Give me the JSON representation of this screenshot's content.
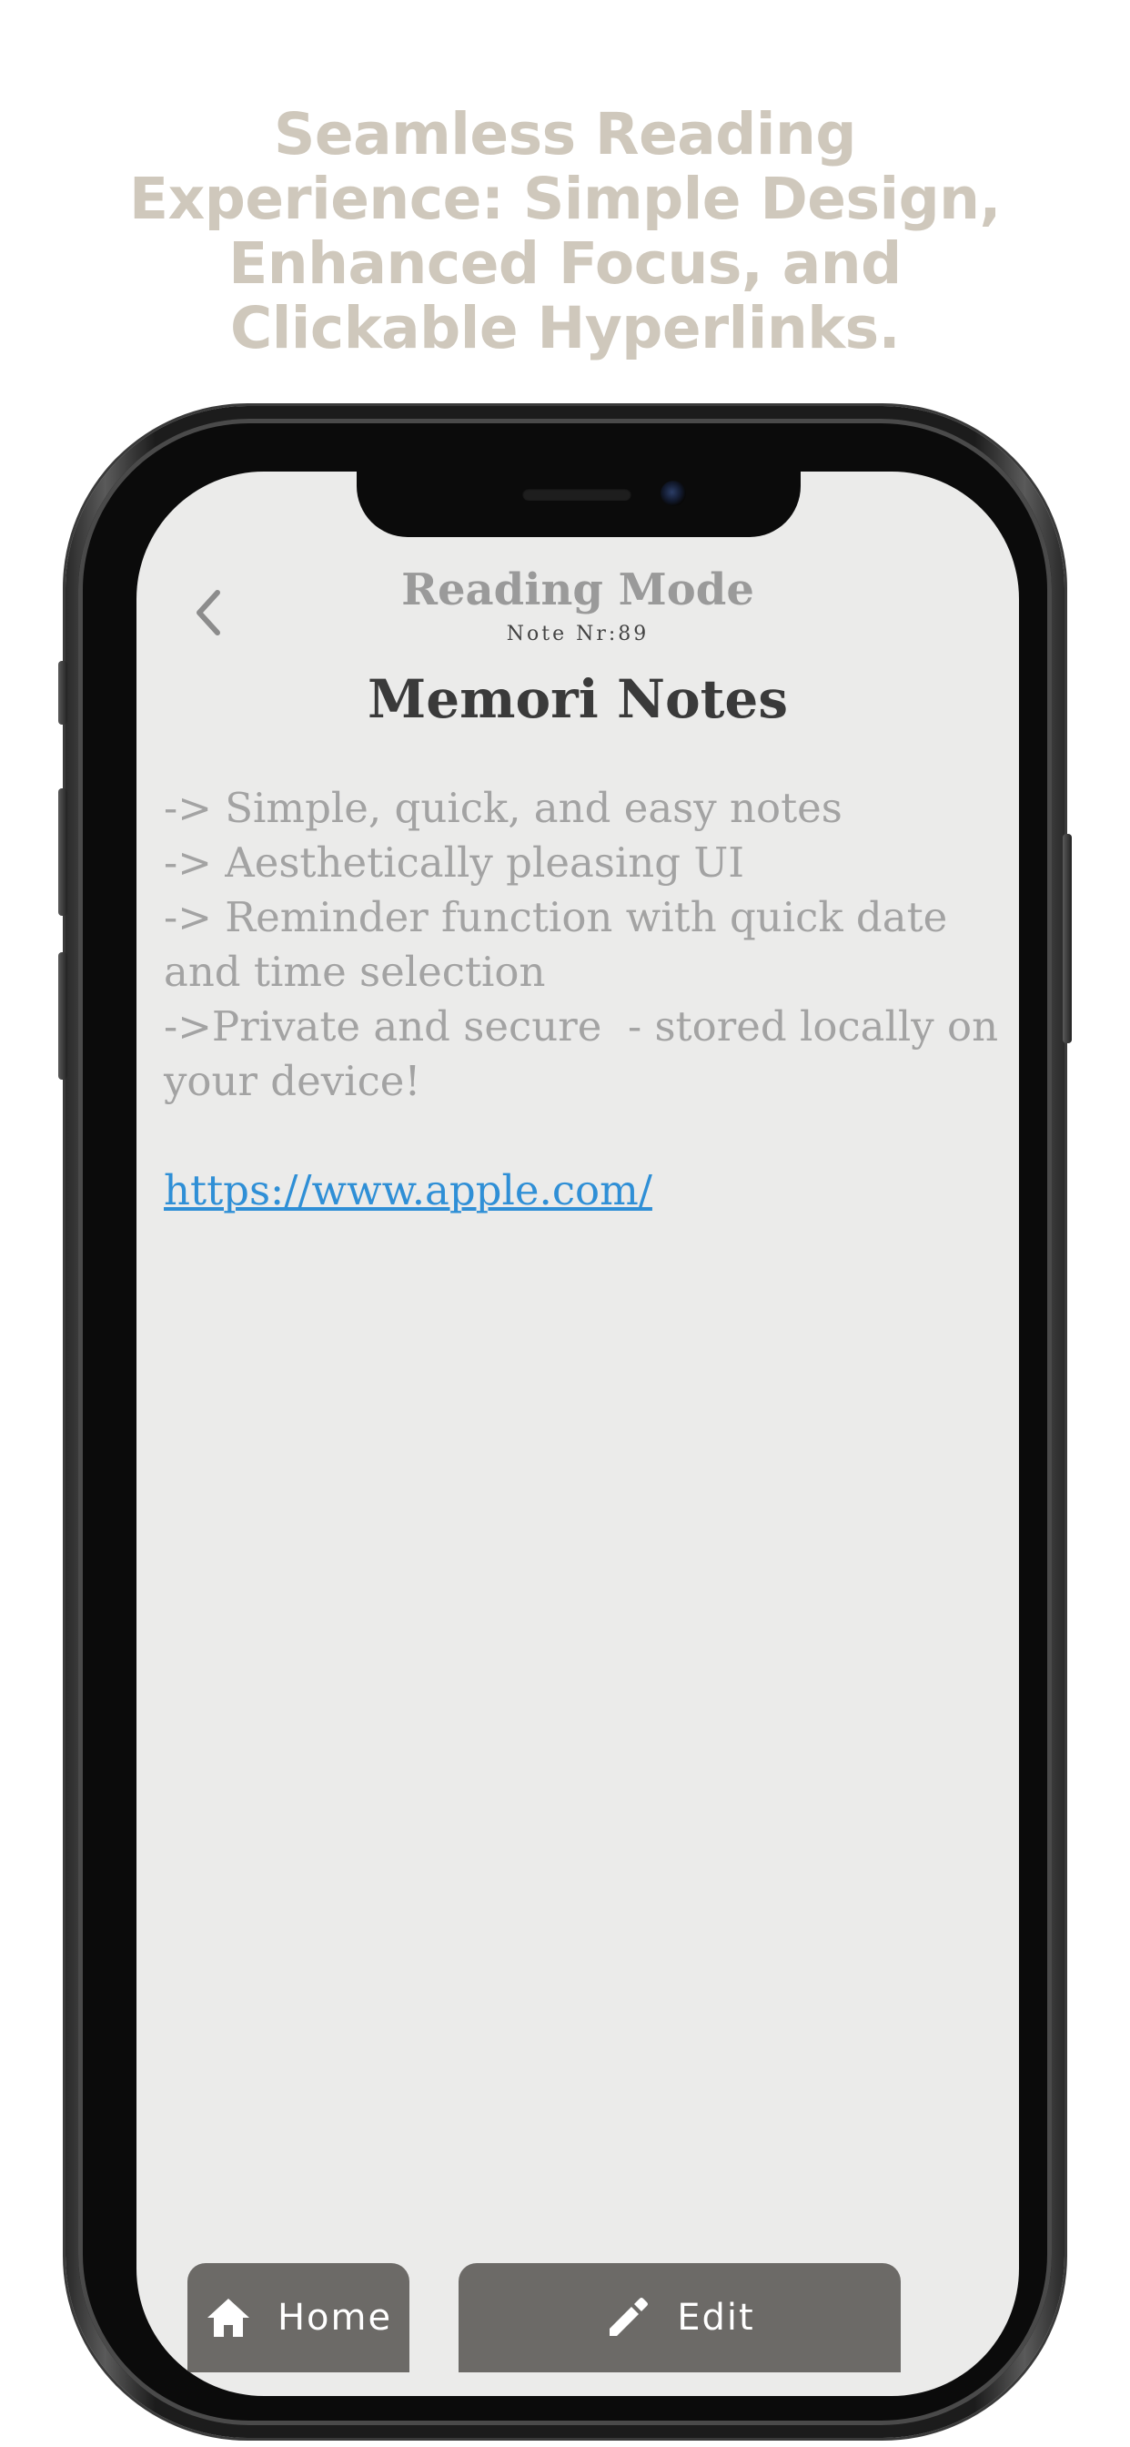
{
  "promo": {
    "headline": "Seamless Reading Experience: Simple Design, Enhanced Focus, and Clickable Hyperlinks."
  },
  "header": {
    "title": "Reading Mode",
    "subtitle": "Note Nr:89",
    "back_icon": "chevron-left-icon"
  },
  "note": {
    "title": "Memori Notes",
    "lines": [
      "-> Simple, quick, and easy notes",
      "-> Aesthetically pleasing UI",
      "-> Reminder function with quick date",
      "and time selection",
      "->Private and secure  - stored locally on",
      "your device!"
    ],
    "link": "https://www.apple.com/"
  },
  "nav": {
    "home_label": "Home",
    "home_icon": "home-icon",
    "edit_label": "Edit",
    "edit_icon": "pencil-icon"
  },
  "colors": {
    "headline": "#cfc8bc",
    "screen_bg": "#ebebea",
    "button_bg": "#6c6a67",
    "link": "#2f8fd6"
  }
}
